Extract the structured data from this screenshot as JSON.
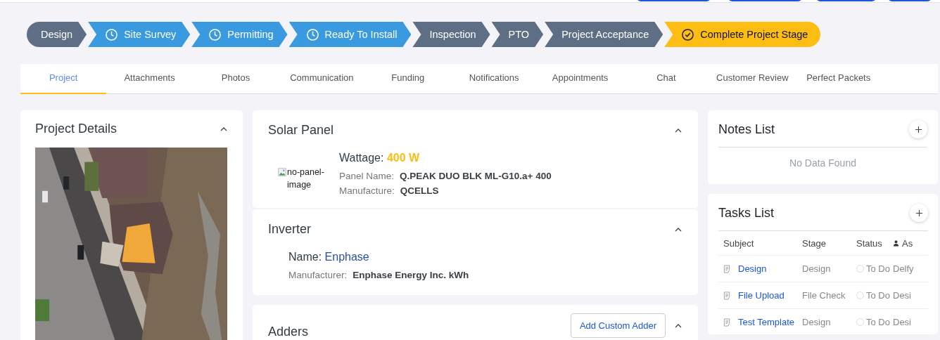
{
  "top_buttons": [
    {
      "kind": "button"
    },
    {
      "kind": "button"
    },
    {
      "kind": "button"
    },
    {
      "kind": "button"
    }
  ],
  "stages": [
    {
      "label": "Design",
      "kind": "plain"
    },
    {
      "label": "Site Survey",
      "kind": "clock"
    },
    {
      "label": "Permitting",
      "kind": "clock"
    },
    {
      "label": "Ready To Install",
      "kind": "clock"
    },
    {
      "label": "Inspection",
      "kind": "plain"
    },
    {
      "label": "PTO",
      "kind": "plain"
    },
    {
      "label": "Project Acceptance",
      "kind": "plain"
    },
    {
      "label": "Complete Project Stage",
      "kind": "check"
    }
  ],
  "tabs": [
    {
      "label": "Project",
      "selected": true
    },
    {
      "label": "Attachments",
      "selected": false
    },
    {
      "label": "Photos",
      "selected": false
    },
    {
      "label": "Communication",
      "selected": false
    },
    {
      "label": "Funding",
      "selected": false
    },
    {
      "label": "Notifications",
      "selected": false
    },
    {
      "label": "Appointments",
      "selected": false
    },
    {
      "label": "Chat",
      "selected": false
    },
    {
      "label": "Customer Review",
      "selected": false
    },
    {
      "label": "Perfect Packets",
      "selected": false
    }
  ],
  "project_details": {
    "title": "Project Details"
  },
  "solar_panel": {
    "title": "Solar Panel",
    "image_alt": "no-panel-image",
    "wattage_label": "Wattage:",
    "wattage": "400 W",
    "fields": [
      {
        "label": "Panel Name:",
        "value": "Q.PEAK DUO BLK ML-G10.a+ 400"
      },
      {
        "label": "Manufacture:",
        "value": "QCELLS"
      }
    ]
  },
  "inverter": {
    "title": "Inverter",
    "name_label": "Name:",
    "name": "Enphase",
    "fields": [
      {
        "label": "Manufacturer:",
        "value": "Enphase Energy Inc. kWh"
      }
    ]
  },
  "adders": {
    "title": "Adders",
    "button": "Add Custom Adder"
  },
  "notes": {
    "title": "Notes List",
    "empty": "No Data Found"
  },
  "tasks": {
    "title": "Tasks List",
    "columns": [
      "Subject",
      "Stage",
      "Status",
      "As"
    ],
    "rows": [
      {
        "subject": "Design",
        "stage": "Design",
        "status": "To Do",
        "assignee": "Delfy"
      },
      {
        "subject": "File Upload",
        "stage": "File Check",
        "status": "To Do",
        "assignee": "Desi"
      },
      {
        "subject": "Test Template",
        "stage": "Design",
        "status": "To Do",
        "assignee": "Desi"
      }
    ]
  }
}
